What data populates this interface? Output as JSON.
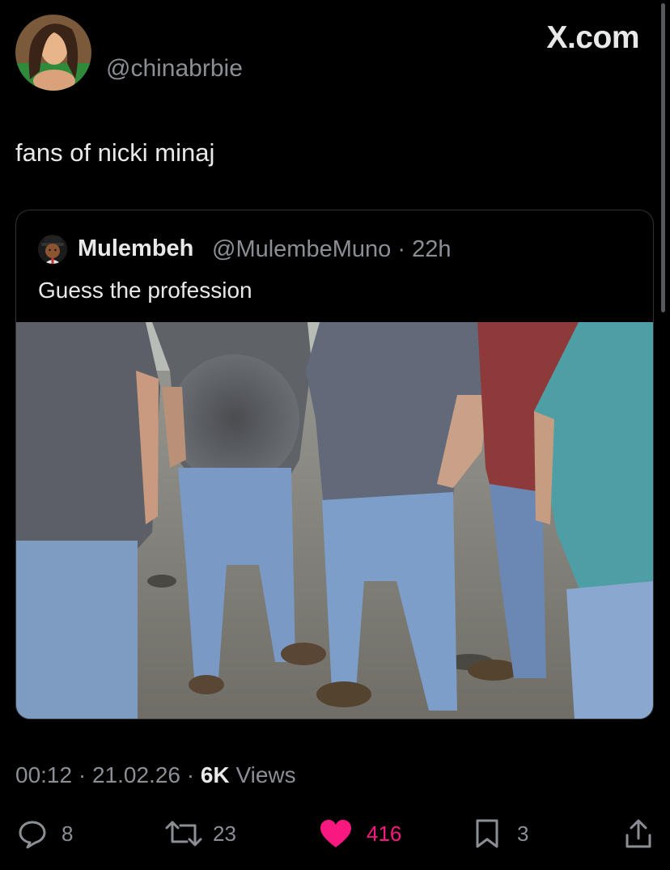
{
  "tweet": {
    "handle": "@chinabrbie",
    "text": "fans of nicki minaj",
    "avatar_icon": "profile-photo"
  },
  "brand": {
    "label": "X.com"
  },
  "quoted": {
    "name": "Mulembeh",
    "handle": "@MulembeMuno",
    "separator": "·",
    "time": "22h",
    "text": "Guess the profession",
    "avatar_icon": "businessman-emoji-avatar"
  },
  "meta": {
    "time": "00:12",
    "date": "21.02.26",
    "views_count": "6K",
    "views_label": "Views",
    "separator": "·"
  },
  "actions": {
    "replies": "8",
    "reposts": "23",
    "likes": "416",
    "bookmarks": "3"
  },
  "colors": {
    "background": "#000000",
    "text": "#e7e9ea",
    "muted": "#8b8f95",
    "like": "#f91880",
    "border": "#2f3336"
  }
}
